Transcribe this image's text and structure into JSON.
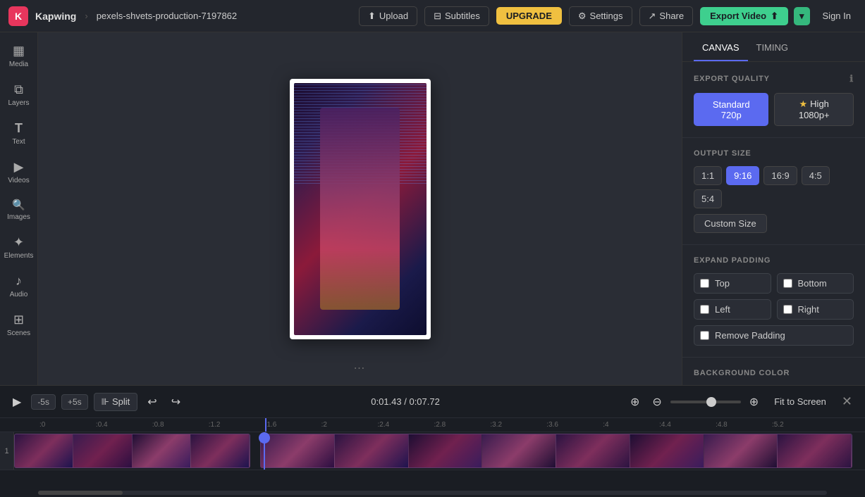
{
  "app": {
    "logo": "K",
    "brand": "Kapwing",
    "separator": "›",
    "project_name": "pexels-shvets-production-7197862"
  },
  "navbar": {
    "upload_label": "Upload",
    "subtitles_label": "Subtitles",
    "upgrade_label": "UPGRADE",
    "settings_label": "Settings",
    "share_label": "Share",
    "export_label": "Export Video",
    "signin_label": "Sign In"
  },
  "sidebar": {
    "items": [
      {
        "id": "media",
        "icon": "▦",
        "label": "Media"
      },
      {
        "id": "layers",
        "icon": "⧉",
        "label": "Layers"
      },
      {
        "id": "text",
        "icon": "T",
        "label": "Text"
      },
      {
        "id": "videos",
        "icon": "▶",
        "label": "Videos"
      },
      {
        "id": "images",
        "icon": "🔍",
        "label": "Images"
      },
      {
        "id": "elements",
        "icon": "✦",
        "label": "Elements"
      },
      {
        "id": "audio",
        "icon": "♪",
        "label": "Audio"
      },
      {
        "id": "scenes",
        "icon": "⊞",
        "label": "Scenes"
      }
    ]
  },
  "right_panel": {
    "tabs": [
      {
        "id": "canvas",
        "label": "CANVAS",
        "active": true
      },
      {
        "id": "timing",
        "label": "TIMING",
        "active": false
      }
    ],
    "export_quality": {
      "title": "EXPORT QUALITY",
      "standard_label": "Standard 720p",
      "high_label": "High 1080p+"
    },
    "output_size": {
      "title": "OUTPUT SIZE",
      "options": [
        "1:1",
        "9:16",
        "16:9",
        "4:5",
        "5:4"
      ],
      "active": "9:16",
      "custom_label": "Custom Size"
    },
    "expand_padding": {
      "title": "EXPAND PADDING",
      "options": [
        {
          "id": "top",
          "label": "Top"
        },
        {
          "id": "bottom",
          "label": "Bottom"
        },
        {
          "id": "left",
          "label": "Left"
        },
        {
          "id": "right",
          "label": "Right"
        },
        {
          "id": "remove",
          "label": "Remove Padding"
        }
      ]
    },
    "background_color": {
      "title": "BACKGROUND COLOR",
      "hex": "#ffffff",
      "presets": [
        {
          "color": "#111111"
        },
        {
          "color": "#e84040"
        },
        {
          "color": "#f0c040"
        },
        {
          "color": "#3ecf8e"
        }
      ]
    }
  },
  "timeline": {
    "skip_back_label": "-5s",
    "skip_forward_label": "+5s",
    "split_label": "Split",
    "timecode": "0:01.43 / 0:07.72",
    "fit_label": "Fit to Screen",
    "ruler_marks": [
      ":0",
      ":0.4",
      ":0.8",
      ":1.2",
      ":1.6",
      ":2",
      ":2.4",
      ":2.8",
      ":3.2",
      ":3.6",
      ":4",
      ":4.4",
      ":4.8",
      ":5.2"
    ],
    "track_label": "1"
  }
}
